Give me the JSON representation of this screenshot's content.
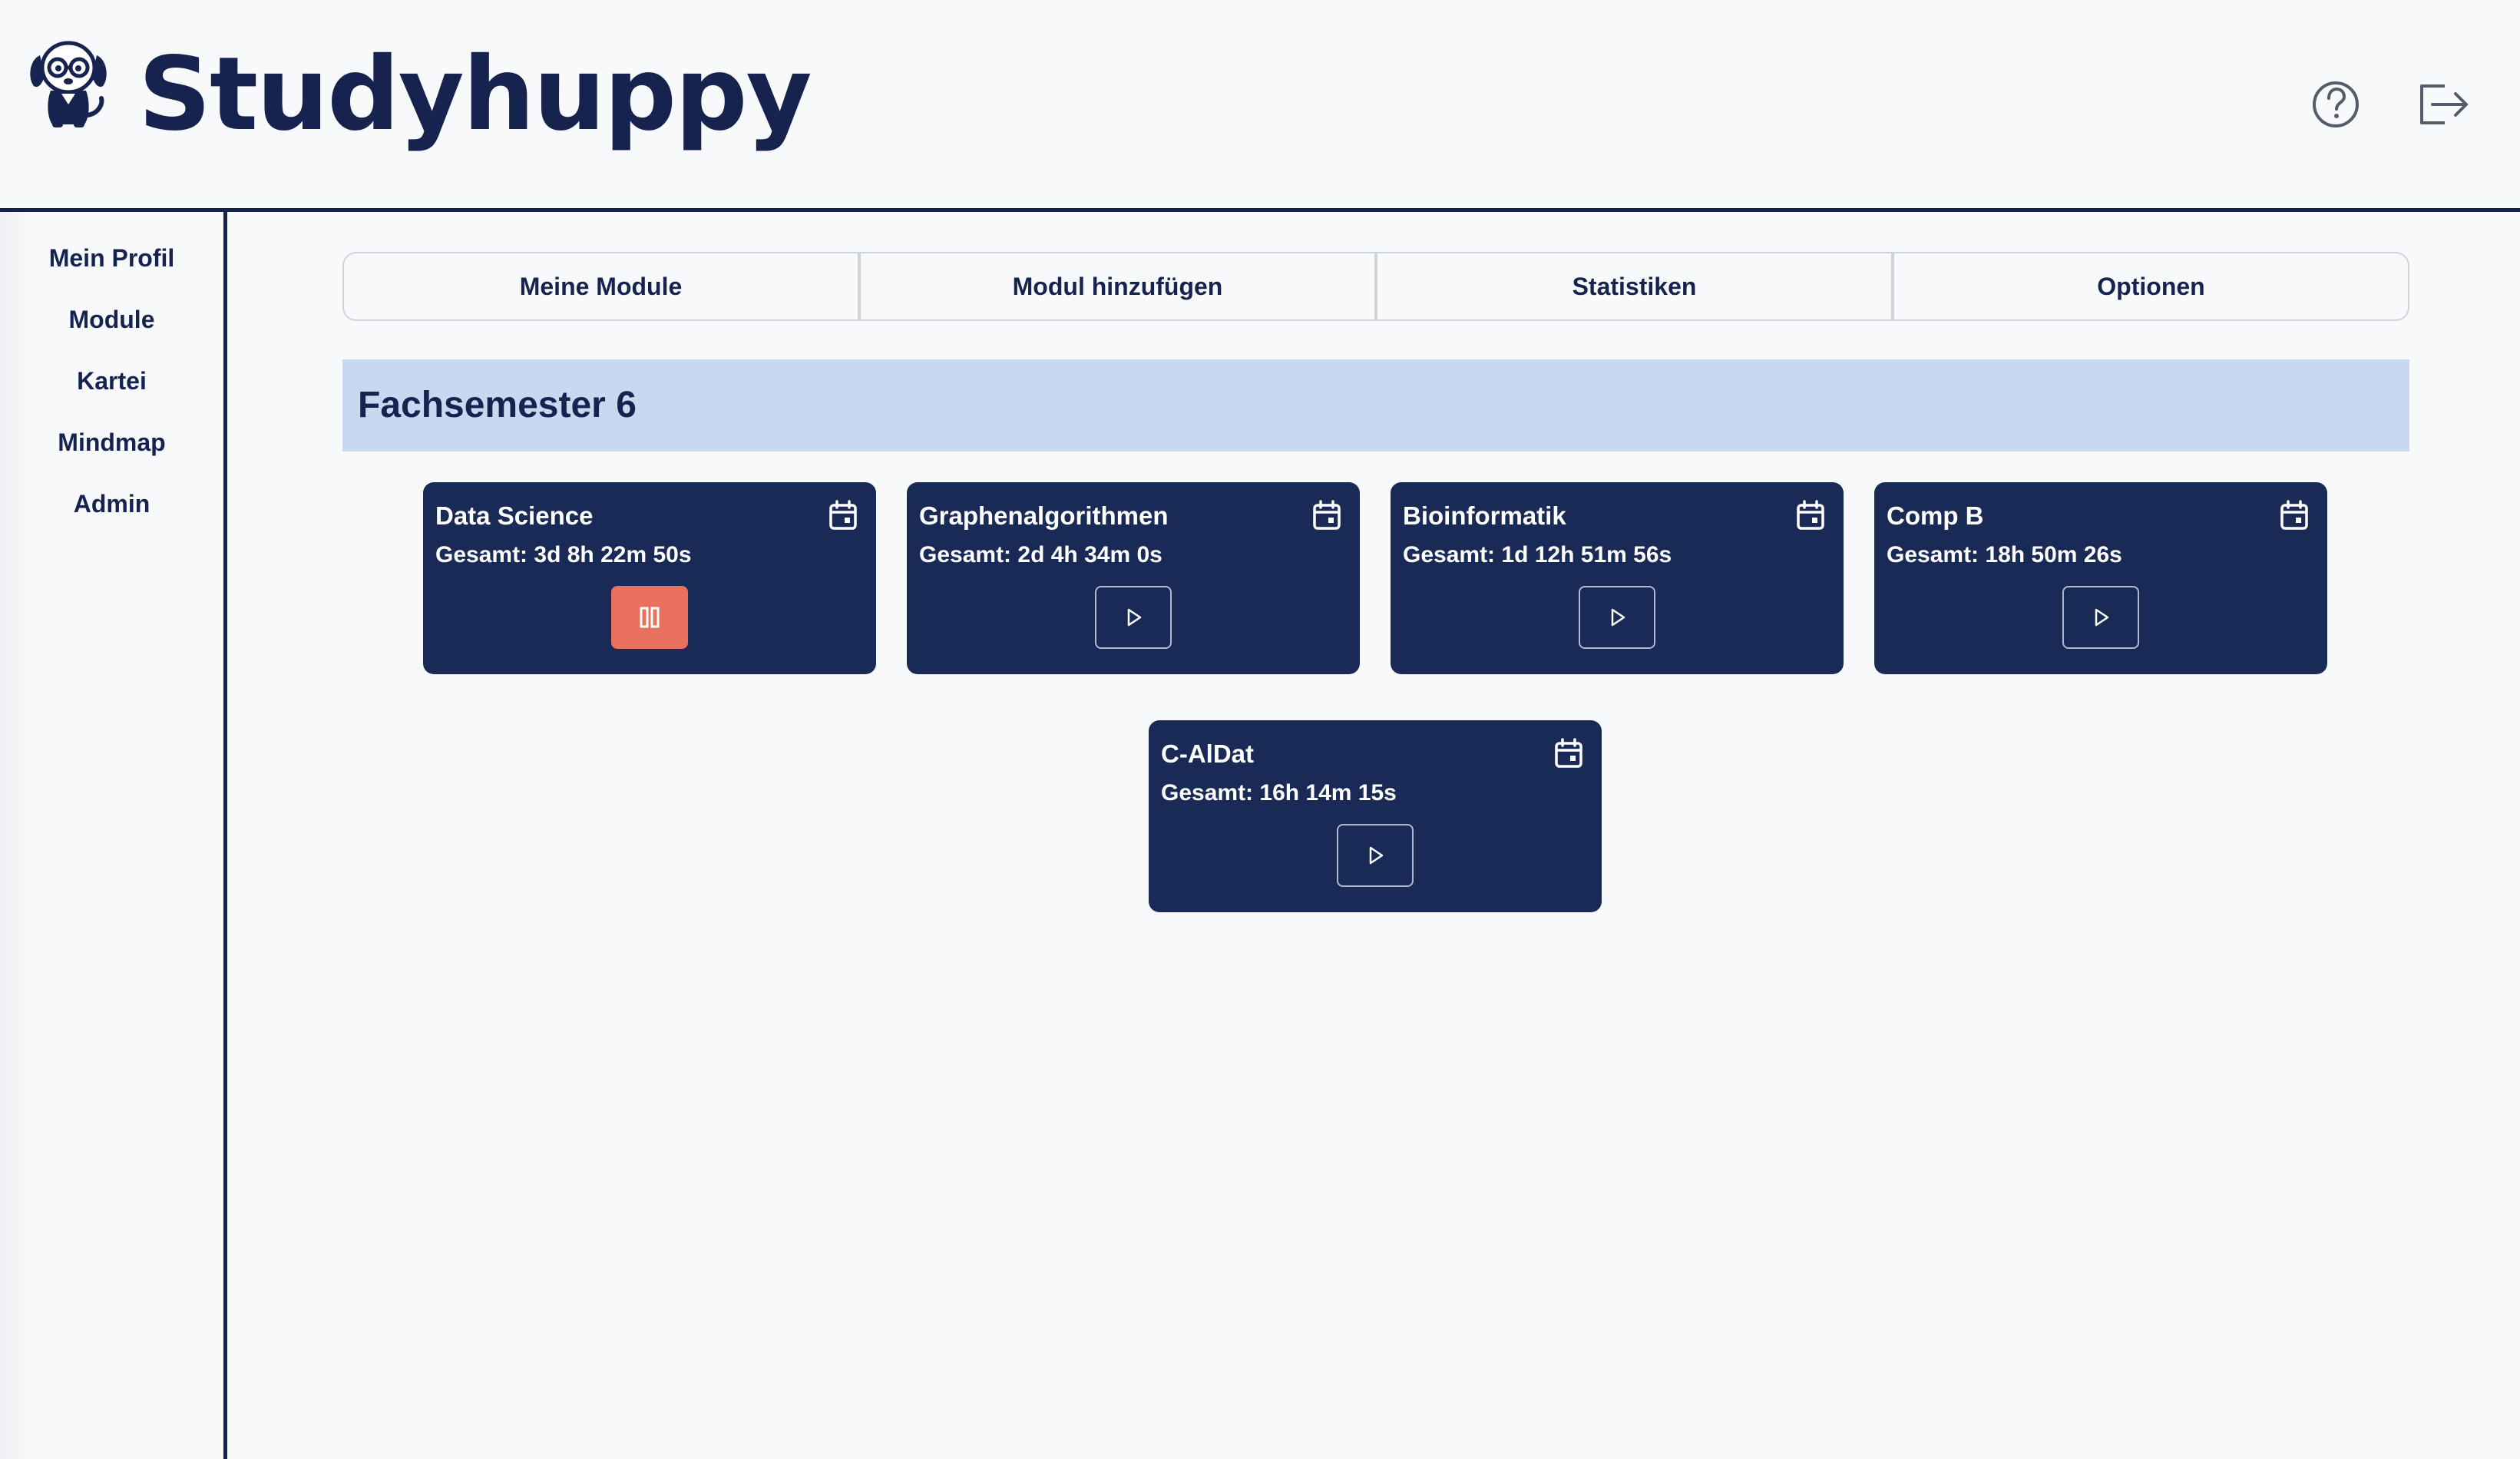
{
  "app": {
    "brand_name": "Studyhuppy"
  },
  "colors": {
    "primary": "#16234f",
    "card_background": "#192a56",
    "banner_background": "#c9d8f1",
    "pause_button": "#e8705d"
  },
  "icons": {
    "logo": "dog-with-glasses-icon",
    "help": "question-circle-icon",
    "logout": "logout-icon",
    "calendar": "calendar-icon",
    "play": "play-icon",
    "pause": "pause-icon"
  },
  "sidebar": {
    "items": [
      {
        "label": "Mein Profil"
      },
      {
        "label": "Module"
      },
      {
        "label": "Kartei"
      },
      {
        "label": "Mindmap"
      },
      {
        "label": "Admin"
      }
    ]
  },
  "tabs": [
    {
      "label": "Meine Module"
    },
    {
      "label": "Modul hinzufügen"
    },
    {
      "label": "Statistiken"
    },
    {
      "label": "Optionen"
    }
  ],
  "semester": {
    "title": "Fachsemester 6",
    "modules": [
      {
        "name": "Data Science",
        "total": "Gesamt: 3d 8h 22m 50s",
        "running": true
      },
      {
        "name": "Graphenalgorithmen",
        "total": "Gesamt: 2d 4h 34m 0s",
        "running": false
      },
      {
        "name": "Bioinformatik",
        "total": "Gesamt: 1d 12h 51m 56s",
        "running": false
      },
      {
        "name": "Comp B",
        "total": "Gesamt: 18h 50m 26s",
        "running": false
      },
      {
        "name": "C-AlDat",
        "total": "Gesamt: 16h 14m 15s",
        "running": false
      }
    ]
  }
}
